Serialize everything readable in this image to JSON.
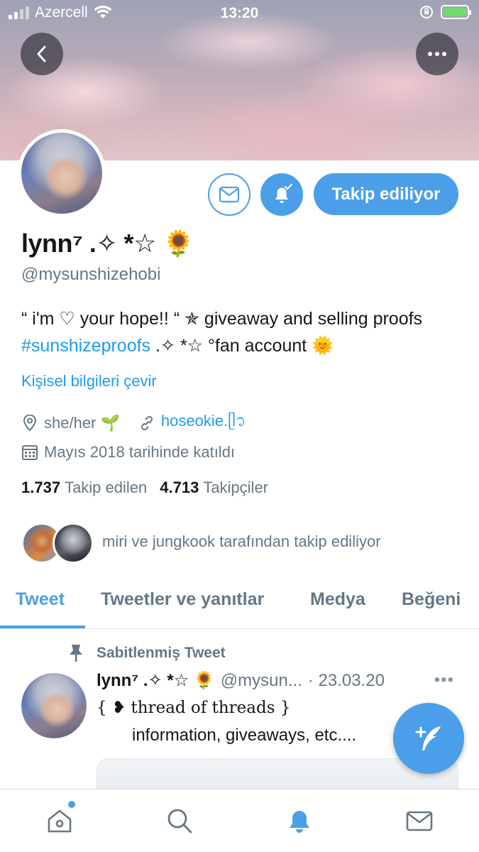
{
  "status_bar": {
    "carrier": "Azercell",
    "time": "13:20"
  },
  "header": {
    "back_icon": "chevron-left-icon",
    "more_icon": "more-horizontal-icon"
  },
  "profile": {
    "name": "lynn⁷ .✧ *☆ 🌻",
    "handle": "@mysunshizehobi",
    "bio_part1": " “ i'm ♡ your hope!! “ ✯ giveaway and selling proofs ",
    "bio_hashtag": "#sunshizeproofs",
    "bio_part2": " .✧ *☆ °fan account 🌞",
    "translate_label": "Kişisel bilgileri çevir",
    "location": "she/her 🌱",
    "website": "hoseokie.ᥫ᭡",
    "joined": "Mayıs 2018 tarihinde katıldı",
    "following_count": "1.737",
    "following_label": "Takip edilen",
    "followers_count": "4.713",
    "followers_label": "Takipçiler",
    "followed_by_text": "miri ve jungkook tarafından takip ediliyor",
    "follow_button_label": "Takip ediliyor",
    "accent_color": "#4a9fe8"
  },
  "tabs": [
    {
      "label": "Tweet"
    },
    {
      "label": "Tweetler ve yanıtlar"
    },
    {
      "label": "Medya"
    },
    {
      "label": "Beğeni"
    }
  ],
  "pinned_tweet": {
    "pinned_label": "Sabitlenmiş Tweet",
    "name": "lynn⁷ .✧ *☆ 🌻",
    "handle": "@mysun...",
    "date": "· 23.03.20",
    "more": "•••",
    "line1": "{ ❥ thread of threads  }",
    "line2": "information, giveaways, etc...."
  },
  "bottom_nav": {
    "items": [
      "home-icon",
      "search-icon",
      "notifications-icon",
      "messages-icon"
    ],
    "active": "notifications-icon"
  }
}
